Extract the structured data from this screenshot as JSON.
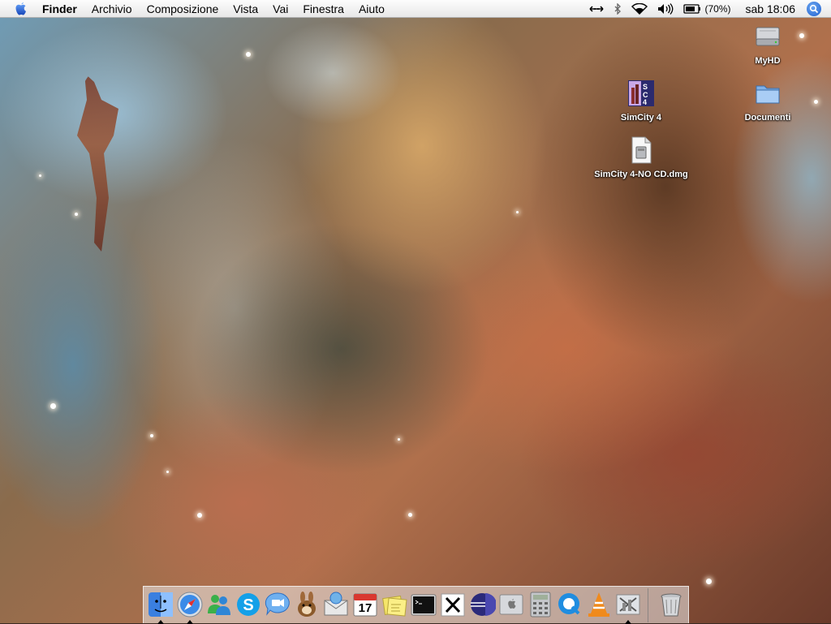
{
  "menubar": {
    "app_name": "Finder",
    "menus": [
      "Archivio",
      "Composizione",
      "Vista",
      "Vai",
      "Finestra",
      "Aiuto"
    ],
    "battery_percent": "(70%)",
    "clock": "sab 18:06",
    "status_icons": [
      "network-arrows-icon",
      "bluetooth-icon",
      "wifi-icon",
      "volume-icon",
      "battery-icon",
      "spotlight-icon"
    ]
  },
  "desktop": {
    "icons": [
      {
        "label": "MyHD",
        "icon": "hard-drive-icon"
      },
      {
        "label": "SimCity 4",
        "icon": "simcity4-app-icon"
      },
      {
        "label": "Documenti",
        "icon": "folder-icon"
      },
      {
        "label": "SimCity 4-NO CD.dmg",
        "icon": "disk-image-icon"
      }
    ]
  },
  "dock": {
    "items": [
      {
        "icon": "finder-icon",
        "running": true
      },
      {
        "icon": "safari-icon",
        "running": true
      },
      {
        "icon": "msn-messenger-icon",
        "running": false
      },
      {
        "icon": "skype-icon",
        "running": false
      },
      {
        "icon": "ichat-icon",
        "running": false
      },
      {
        "icon": "adium-icon",
        "running": false
      },
      {
        "icon": "mail-icon",
        "running": false
      },
      {
        "icon": "ical-icon",
        "running": false,
        "badge": "17"
      },
      {
        "icon": "stickies-icon",
        "running": false
      },
      {
        "icon": "terminal-icon",
        "running": false
      },
      {
        "icon": "x11-icon",
        "running": false
      },
      {
        "icon": "eclipse-icon",
        "running": false
      },
      {
        "icon": "boot-camp-icon",
        "running": false
      },
      {
        "icon": "calculator-icon",
        "running": false
      },
      {
        "icon": "quicktime-icon",
        "running": false
      },
      {
        "icon": "vlc-icon",
        "running": false
      },
      {
        "icon": "simcity4-app-icon",
        "running": true
      },
      {
        "icon": "trash-icon",
        "running": false
      }
    ]
  },
  "colors": {
    "menubar_bg": "#f2f2f2",
    "spotlight_blue": "#1c5fd0",
    "desktop_label": "#ffffff"
  }
}
